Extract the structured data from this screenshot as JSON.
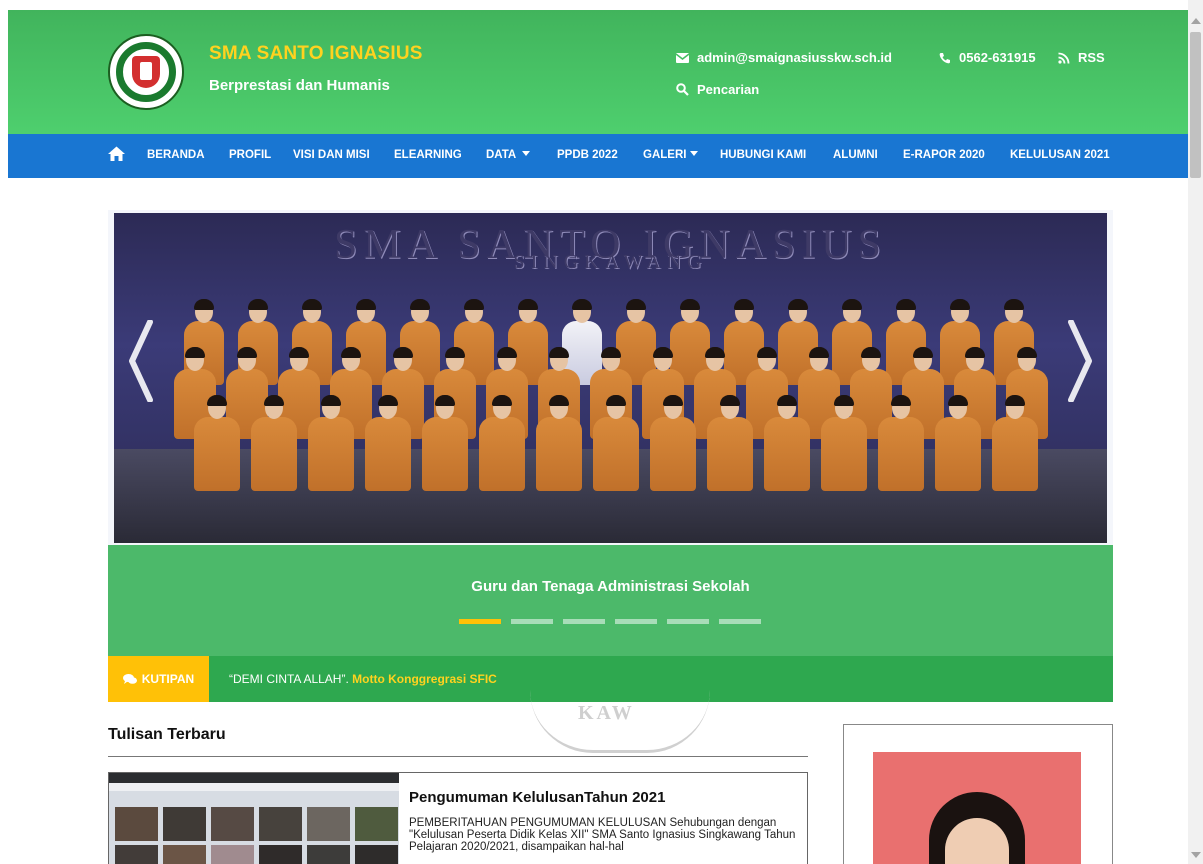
{
  "site": {
    "name": "SMA SANTO IGNASIUS",
    "tagline": "Berprestasi dan Humanis"
  },
  "contact": {
    "email": "admin@smaignasiusskw.sch.id",
    "phone": "0562-631915",
    "rss": "RSS",
    "search": "Pencarian"
  },
  "nav": {
    "items": [
      {
        "label": "BERANDA"
      },
      {
        "label": "PROFIL"
      },
      {
        "label": "VISI DAN MISI"
      },
      {
        "label": "ELEARNING"
      },
      {
        "label": "DATA"
      },
      {
        "label": "PPDB 2022"
      },
      {
        "label": "GALERI"
      },
      {
        "label": "HUBUNGI KAMI"
      },
      {
        "label": "ALUMNI"
      },
      {
        "label": "E-RAPOR 2020"
      },
      {
        "label": "KELULUSAN 2021"
      }
    ]
  },
  "slider": {
    "photo_heading": "SMA SANTO IGNASIUS",
    "photo_subheading": "SINGKAWANG",
    "caption": "Guru dan Tenaga Administrasi Sekolah",
    "slide_count": 6,
    "active_slide": 1
  },
  "quote": {
    "label": "KUTIPAN",
    "text": "“DEMI CINTA ALLAH”.",
    "author": "Motto Konggregrasi SFIC"
  },
  "latest": {
    "heading": "Tulisan Terbaru",
    "posts": [
      {
        "title": "Pengumuman KelulusanTahun 2021",
        "excerpt": "PEMBERITAHUAN PENGUMUMAN KELULUSAN Sehubungan dengan \"Kelulusan Peserta Didik Kelas XII\" SMA Santo Ignasius Singkawang Tahun Pelajaran 2020/2021, disampaikan hal-hal"
      }
    ]
  },
  "watermark": "KAW",
  "colors": {
    "header_green": "#41b45c",
    "nav_blue": "#1976d2",
    "accent_yellow": "#ffc107",
    "caption_green": "#4cb96a",
    "quote_green": "#2ea84f"
  },
  "icons": {
    "home": "home-icon",
    "email": "envelope-icon",
    "phone": "phone-icon",
    "rss": "rss-icon",
    "search": "search-icon",
    "quote": "comments-icon"
  }
}
